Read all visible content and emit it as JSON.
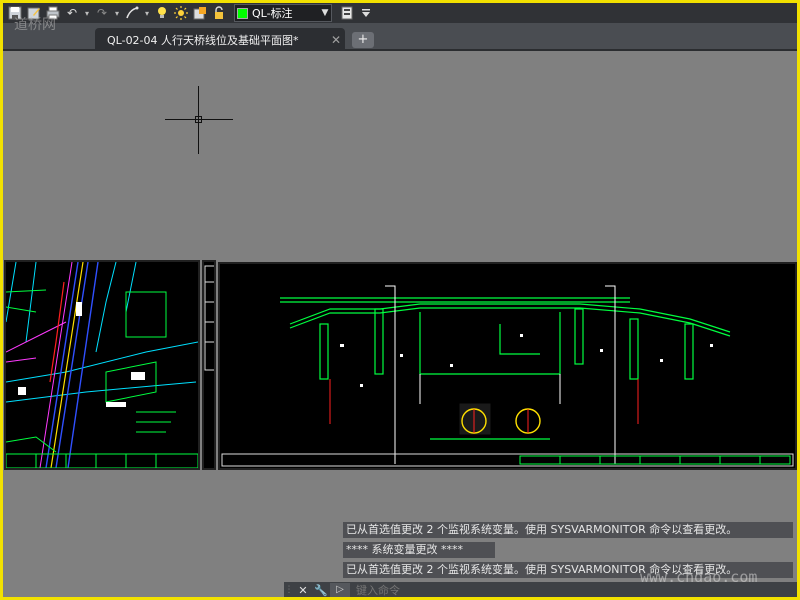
{
  "toolbar": {
    "icons": [
      "save-icon",
      "save-as-icon",
      "print-icon",
      "undo-icon",
      "redo-icon",
      "match-properties-icon",
      "light-bulb-icon",
      "sun-icon",
      "layer-freeze-icon",
      "lock-icon"
    ],
    "layer": {
      "name": "QL-标注",
      "swatch_color": "#00ff00"
    },
    "undo_glyph": "↶",
    "redo_glyph": "↷",
    "dropdown_glyph": "▾",
    "caret_glyph": "▼"
  },
  "watermark_top": "道桥网",
  "tabs": {
    "active_label": "QL-02-04 人行天桥线位及基础平面图*",
    "close_glyph": "✕",
    "new_glyph": "+"
  },
  "command_history": [
    "已从首选值更改 2 个监视系统变量。使用 SYSVARMONITOR 命令以查看更改。",
    "**** 系统变量更改 ****",
    "已从首选值更改 2 个监视系统变量。使用 SYSVARMONITOR 命令以查看更改。"
  ],
  "command_bar": {
    "close_glyph": "✕",
    "settings_glyph": "🔧",
    "prompt_glyph": "▷",
    "placeholder": "键入命令"
  },
  "watermark_bottom": "www.chdao.com",
  "colors": {
    "frame_border": "#f2e100",
    "model_space_bg": "#808080",
    "viewport_bg": "#000000"
  }
}
